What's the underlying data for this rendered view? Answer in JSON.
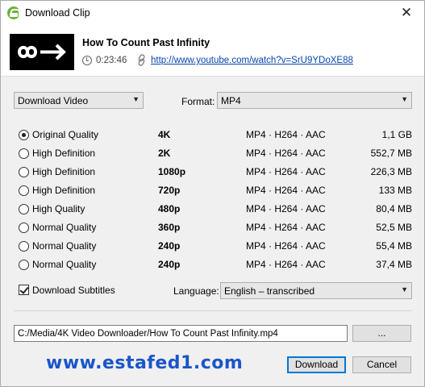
{
  "window": {
    "title": "Download Clip",
    "close_glyph": "✕"
  },
  "video": {
    "title": "How To Count Past Infinity",
    "duration": "0:23:46",
    "url": "http://www.youtube.com/watch?v=SrU9YDoXE88"
  },
  "controls": {
    "mode_dropdown": "Download Video",
    "format_label": "Format:",
    "format_value": "MP4",
    "dropdown_arrow": "▼"
  },
  "qualities": [
    {
      "label": "Original Quality",
      "resolution": "4K",
      "codec": "MP4 · H264 · AAC",
      "size": "1,1 GB",
      "selected": true
    },
    {
      "label": "High Definition",
      "resolution": "2K",
      "codec": "MP4 · H264 · AAC",
      "size": "552,7 MB",
      "selected": false
    },
    {
      "label": "High Definition",
      "resolution": "1080p",
      "codec": "MP4 · H264 · AAC",
      "size": "226,3 MB",
      "selected": false
    },
    {
      "label": "High Definition",
      "resolution": "720p",
      "codec": "MP4 · H264 · AAC",
      "size": "133 MB",
      "selected": false
    },
    {
      "label": "High Quality",
      "resolution": "480p",
      "codec": "MP4 · H264 · AAC",
      "size": "80,4 MB",
      "selected": false
    },
    {
      "label": "Normal Quality",
      "resolution": "360p",
      "codec": "MP4 · H264 · AAC",
      "size": "52,5 MB",
      "selected": false
    },
    {
      "label": "Normal Quality",
      "resolution": "240p",
      "codec": "MP4 · H264 · AAC",
      "size": "55,4 MB",
      "selected": false
    },
    {
      "label": "Normal Quality",
      "resolution": "240p",
      "codec": "MP4 · H264 · AAC",
      "size": "37,4 MB",
      "selected": false
    }
  ],
  "subtitles": {
    "checkbox_label": "Download Subtitles",
    "checked": true,
    "language_label": "Language:",
    "language_value": "English – transcribed"
  },
  "output": {
    "path": "C:/Media/4K Video Downloader/How To Count Past Infinity.mp4",
    "browse_label": "...",
    "download_label": "Download",
    "cancel_label": "Cancel"
  },
  "watermark": "www.estafed1.com",
  "colors": {
    "accent": "#0078d7",
    "link": "#0645ad",
    "watermark": "#1a55c9",
    "app_icon": "#6cb33f"
  }
}
